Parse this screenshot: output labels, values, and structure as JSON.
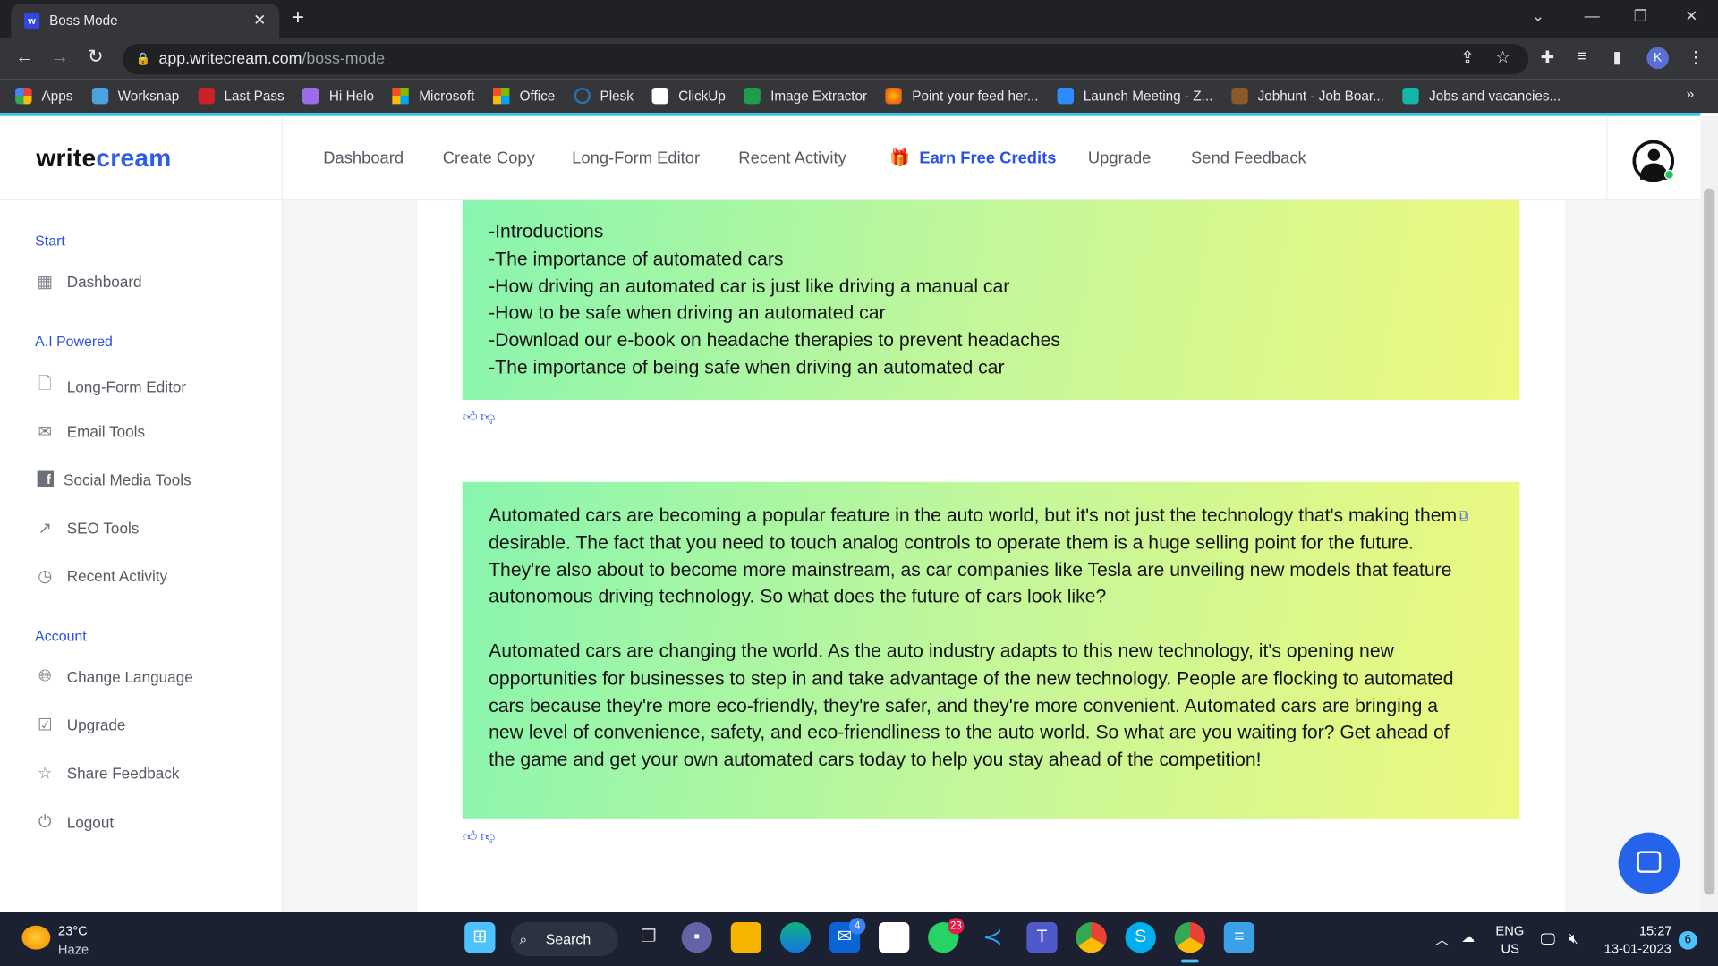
{
  "browser": {
    "tab_title": "Boss Mode",
    "url_host": "app.writecream.com",
    "url_path": "/boss-mode",
    "bookmarks": [
      "Apps",
      "Worksnap",
      "Last Pass",
      "Hi Helo",
      "Microsoft",
      "Office",
      "Plesk",
      "ClickUp",
      "Image Extractor",
      "Point your feed her...",
      "Launch Meeting - Z...",
      "Jobhunt - Job Boar...",
      "Jobs and vacancies..."
    ],
    "profile_initial": "K"
  },
  "header": {
    "logo_a": "write",
    "logo_b": "cream",
    "nav": [
      "Dashboard",
      "Create Copy",
      "Long-Form Editor",
      "Recent Activity",
      "Earn Free Credits",
      "Upgrade",
      "Send Feedback"
    ]
  },
  "sidebar": {
    "sections": [
      {
        "title": "Start",
        "items": [
          "Dashboard"
        ]
      },
      {
        "title": "A.I Powered",
        "items": [
          "Long-Form Editor",
          "Email Tools",
          "Social Media Tools",
          "SEO Tools",
          "Recent Activity"
        ]
      },
      {
        "title": "Account",
        "items": [
          "Change Language",
          "Upgrade",
          "Share Feedback",
          "Logout"
        ]
      }
    ]
  },
  "results": [
    {
      "lines": [
        "-Introductions",
        "-The importance of automated cars",
        "-How driving an automated car is just like driving a manual car",
        "-How to be safe when driving an automated car",
        "-Download our e-book on headache therapies to prevent headaches",
        "-The importance of being safe when driving an automated car"
      ]
    },
    {
      "paragraphs": [
        "Automated cars are becoming a popular feature in the auto world, but it's not just the technology that's making them desirable. The fact that you need to touch analog controls to operate them is a huge selling point for the future. They're also about to become more mainstream, as car companies like Tesla are unveiling new models that feature autonomous driving technology. So what does the future of cars look like?",
        "Automated cars are changing the world. As the auto industry adapts to this new technology, it's opening new opportunities for businesses to step in and take advantage of the new technology. People are flocking to automated cars because they're more eco-friendly, they're safer, and they're more convenient. Automated cars are bringing a new level of convenience, safety, and eco-friendliness to the auto world. So what are you waiting for? Get ahead of the game and get your own automated cars today to help you stay ahead of the competition!"
      ]
    }
  ],
  "taskbar": {
    "weather_temp": "23°C",
    "weather_desc": "Haze",
    "search_label": "Search",
    "mail_badge": "4",
    "whatsapp_badge": "23",
    "lang": "ENG",
    "region": "US",
    "time": "15:27",
    "date": "13-01-2023",
    "notif_count": "6"
  },
  "colors": {
    "accent": "#2b50e6",
    "cyan_bar": "#2ec5e0",
    "gradient_start": "#88f5ae",
    "gradient_end": "#eef87e"
  }
}
